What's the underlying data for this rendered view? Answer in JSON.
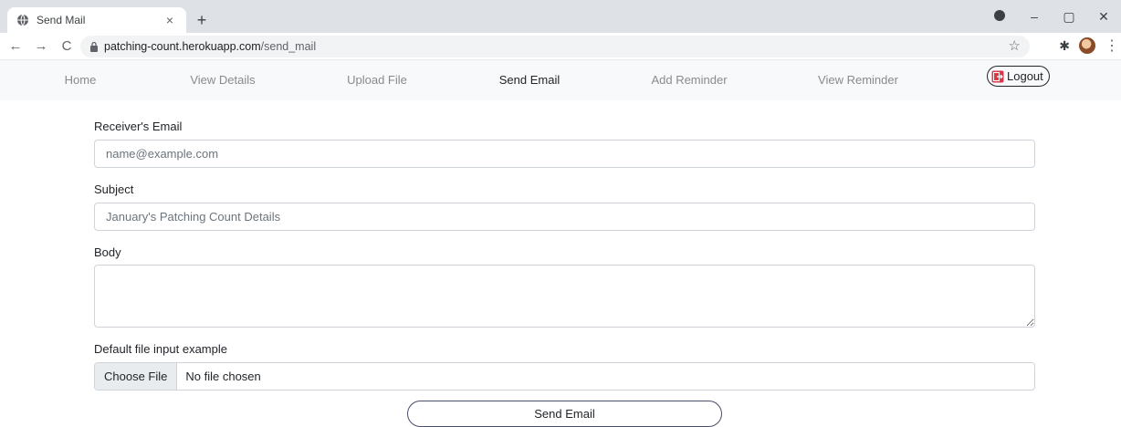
{
  "browser": {
    "tab_title": "Send Mail",
    "tab_close": "×",
    "new_tab": "+",
    "url_host": "patching-count.herokuapp.com",
    "url_path": "/send_mail",
    "back": "←",
    "forward": "→",
    "reload": "C",
    "bookmark": "☆",
    "extensions": "✱",
    "menu": "⋮",
    "minimize": "–",
    "maximize": "▢",
    "close": "✕"
  },
  "nav": {
    "items": [
      {
        "label": "Home"
      },
      {
        "label": "View Details"
      },
      {
        "label": "Upload File"
      },
      {
        "label": "Send Email"
      },
      {
        "label": "Add Reminder"
      },
      {
        "label": "View Reminder"
      }
    ],
    "active": "Send Email",
    "logout_label": "Logout"
  },
  "form": {
    "receiver_label": "Receiver's Email",
    "receiver_placeholder": "name@example.com",
    "subject_label": "Subject",
    "subject_placeholder": "January's Patching Count Details",
    "body_label": "Body",
    "file_label": "Default file input example",
    "file_button": "Choose File",
    "file_status": "No file chosen",
    "submit_label": "Send Email"
  },
  "colors": {
    "navbar_bg": "#f8f9fa",
    "logout_icon": "#dc3545",
    "nav_inactive": "#8a8a8a",
    "nav_active": "#212529"
  }
}
